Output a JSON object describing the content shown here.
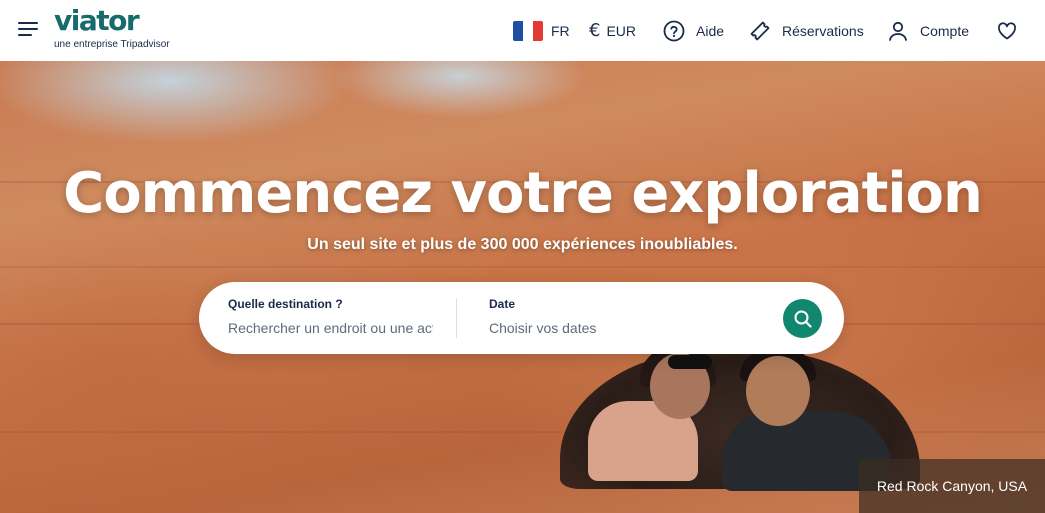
{
  "brand": {
    "name": "viator",
    "tagline": "une entreprise Tripadvisor",
    "color": "#186b6d"
  },
  "nav": {
    "language": {
      "label": "FR",
      "icon": "france-flag-icon"
    },
    "currency": {
      "label": "EUR",
      "icon": "euro-icon"
    },
    "help": {
      "label": "Aide",
      "icon": "help-circle-icon"
    },
    "bookings": {
      "label": "Réservations",
      "icon": "ticket-icon"
    },
    "account": {
      "label": "Compte",
      "icon": "user-icon"
    },
    "wishlist": {
      "icon": "heart-icon"
    }
  },
  "hero": {
    "title": "Commencez votre exploration",
    "subtitle": "Un seul site et plus de 300 000 expériences inoubliables.",
    "photo_caption": "Red Rock Canyon, USA"
  },
  "search": {
    "destination_label": "Quelle destination ?",
    "destination_placeholder": "Rechercher un endroit ou une activité",
    "date_label": "Date",
    "date_placeholder": "Choisir vos dates",
    "button_icon": "search-icon",
    "button_color": "#12876f"
  }
}
